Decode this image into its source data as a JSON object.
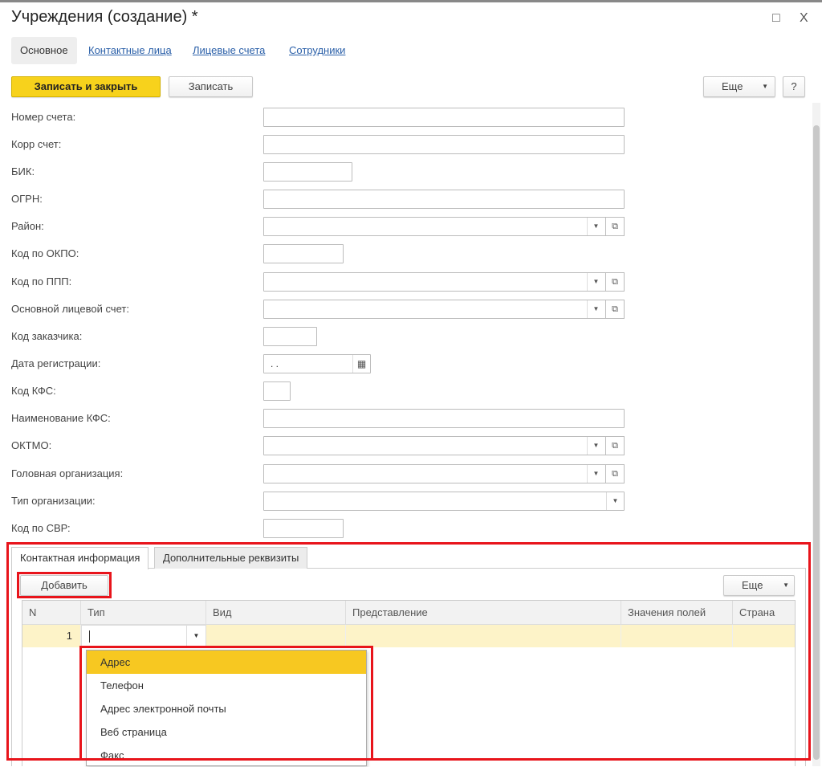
{
  "window": {
    "title": "Учреждения (создание) *",
    "maximize_icon": "□",
    "close_icon": "X"
  },
  "nav_tabs": [
    "Основное",
    "Контактные лица",
    "Лицевые счета",
    "Сотрудники"
  ],
  "toolbar": {
    "save_close": "Записать и закрыть",
    "save": "Записать",
    "more": "Еще",
    "help": "?"
  },
  "fields": [
    {
      "label": "Номер счета:",
      "value": ""
    },
    {
      "label": "Корр счет:",
      "value": ""
    },
    {
      "label": "БИК:",
      "value": ""
    },
    {
      "label": "ОГРН:",
      "value": ""
    },
    {
      "label": "Район:",
      "value": ""
    },
    {
      "label": "Код по ОКПО:",
      "value": ""
    },
    {
      "label": "Код по ППП:",
      "value": ""
    },
    {
      "label": "Основной лицевой счет:",
      "value": ""
    },
    {
      "label": "Код заказчика:",
      "value": ""
    },
    {
      "label": "Дата регистрации:",
      "value": " .  ."
    },
    {
      "label": "Код КФС:",
      "value": ""
    },
    {
      "label": "Наименование КФС:",
      "value": ""
    },
    {
      "label": "ОКТМО:",
      "value": ""
    },
    {
      "label": "Головная организация:",
      "value": ""
    },
    {
      "label": "Тип организации:",
      "value": ""
    },
    {
      "label": "Код по СВР:",
      "value": ""
    }
  ],
  "subtabs": [
    "Контактная информация",
    "Дополнительные реквизиты"
  ],
  "contact": {
    "add": "Добавить",
    "more": "Еще",
    "columns": [
      "N",
      "Тип",
      "Вид",
      "Представление",
      "Значения полей",
      "Страна"
    ],
    "rows": [
      {
        "n": "1",
        "type": ""
      }
    ],
    "dropdown": [
      "Адрес",
      "Телефон",
      "Адрес электронной почты",
      "Веб страница",
      "Факс"
    ],
    "selected_index": 0
  },
  "colors": {
    "accent": "#f7d21c",
    "highlight": "#f7c821",
    "row": "#fdf3c8",
    "annotation": "#e8141b"
  }
}
